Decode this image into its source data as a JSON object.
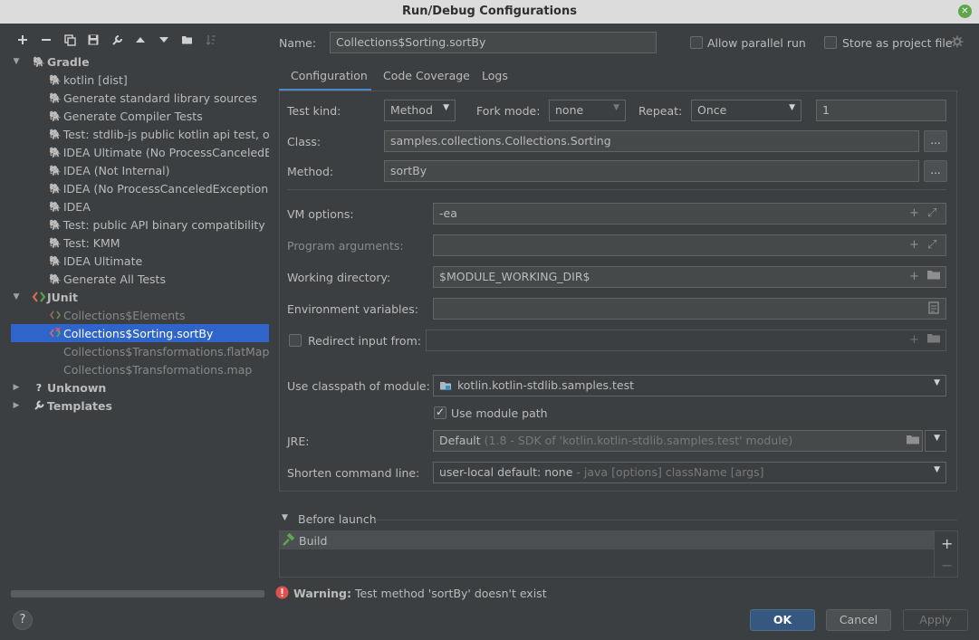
{
  "window": {
    "title": "Run/Debug Configurations",
    "close_glyph": "✕"
  },
  "toolbar": {
    "icons": [
      "plus-icon",
      "minus-icon",
      "copy-icon",
      "save-icon",
      "wrench-icon",
      "arrow-up-icon",
      "arrow-down-icon",
      "folder-icon",
      "sort-icon"
    ]
  },
  "tree": {
    "gradle": {
      "label": "Gradle",
      "items": [
        "kotlin [dist]",
        "Generate standard library sources",
        "Generate Compiler Tests",
        "Test: stdlib-js public kotlin api test, ove",
        "IDEA Ultimate (No ProcessCanceledEx",
        "IDEA (Not Internal)",
        "IDEA (No ProcessCanceledException)",
        "IDEA",
        "Test: public API binary compatibility va",
        "Test: KMM",
        "IDEA Ultimate",
        "Generate All Tests"
      ]
    },
    "junit": {
      "label": "JUnit",
      "items": [
        "Collections$Elements",
        "Collections$Sorting.sortBy",
        "Collections$Transformations.flatMap",
        "Collections$Transformations.map"
      ],
      "selected": "Collections$Sorting.sortBy"
    },
    "unknown": {
      "label": "Unknown"
    },
    "templates": {
      "label": "Templates"
    }
  },
  "header": {
    "name_label": "Name:",
    "name_value": "Collections$Sorting.sortBy",
    "allow_parallel": "Allow parallel run",
    "store_project": "Store as project file"
  },
  "tabs": [
    "Configuration",
    "Code Coverage",
    "Logs"
  ],
  "config": {
    "test_kind_label": "Test kind:",
    "test_kind_value": "Method",
    "fork_mode_label": "Fork mode:",
    "fork_mode_value": "none",
    "repeat_label": "Repeat:",
    "repeat_value": "Once",
    "repeat_count": "1",
    "class_label": "Class:",
    "class_value": "samples.collections.Collections.Sorting",
    "method_label": "Method:",
    "method_value": "sortBy",
    "dots": "...",
    "vm_label": "VM options:",
    "vm_value": "-ea",
    "program_args_label": "Program arguments:",
    "working_dir_label": "Working directory:",
    "working_dir_value": "$MODULE_WORKING_DIR$",
    "env_label": "Environment variables:",
    "redirect_label": "Redirect input from:",
    "classpath_label": "Use classpath of module:",
    "classpath_value": "kotlin.kotlin-stdlib.samples.test",
    "module_path_label": "Use module path",
    "jre_label": "JRE:",
    "jre_value": "Default",
    "jre_hint": "(1.8 - SDK of 'kotlin.kotlin-stdlib.samples.test' module)",
    "shorten_label": "Shorten command line:",
    "shorten_value": "user-local default: none",
    "shorten_hint": "- java [options] className [args]"
  },
  "before_launch": {
    "label": "Before launch",
    "items": [
      "Build"
    ]
  },
  "warning": {
    "bold": "Warning:",
    "text": "Test method 'sortBy' doesn't exist"
  },
  "buttons": {
    "ok": "OK",
    "cancel": "Cancel",
    "apply": "Apply",
    "help": "?"
  },
  "colors": {
    "selection": "#2f65ca",
    "primary_button": "#365880",
    "warning": "#e0504d"
  }
}
